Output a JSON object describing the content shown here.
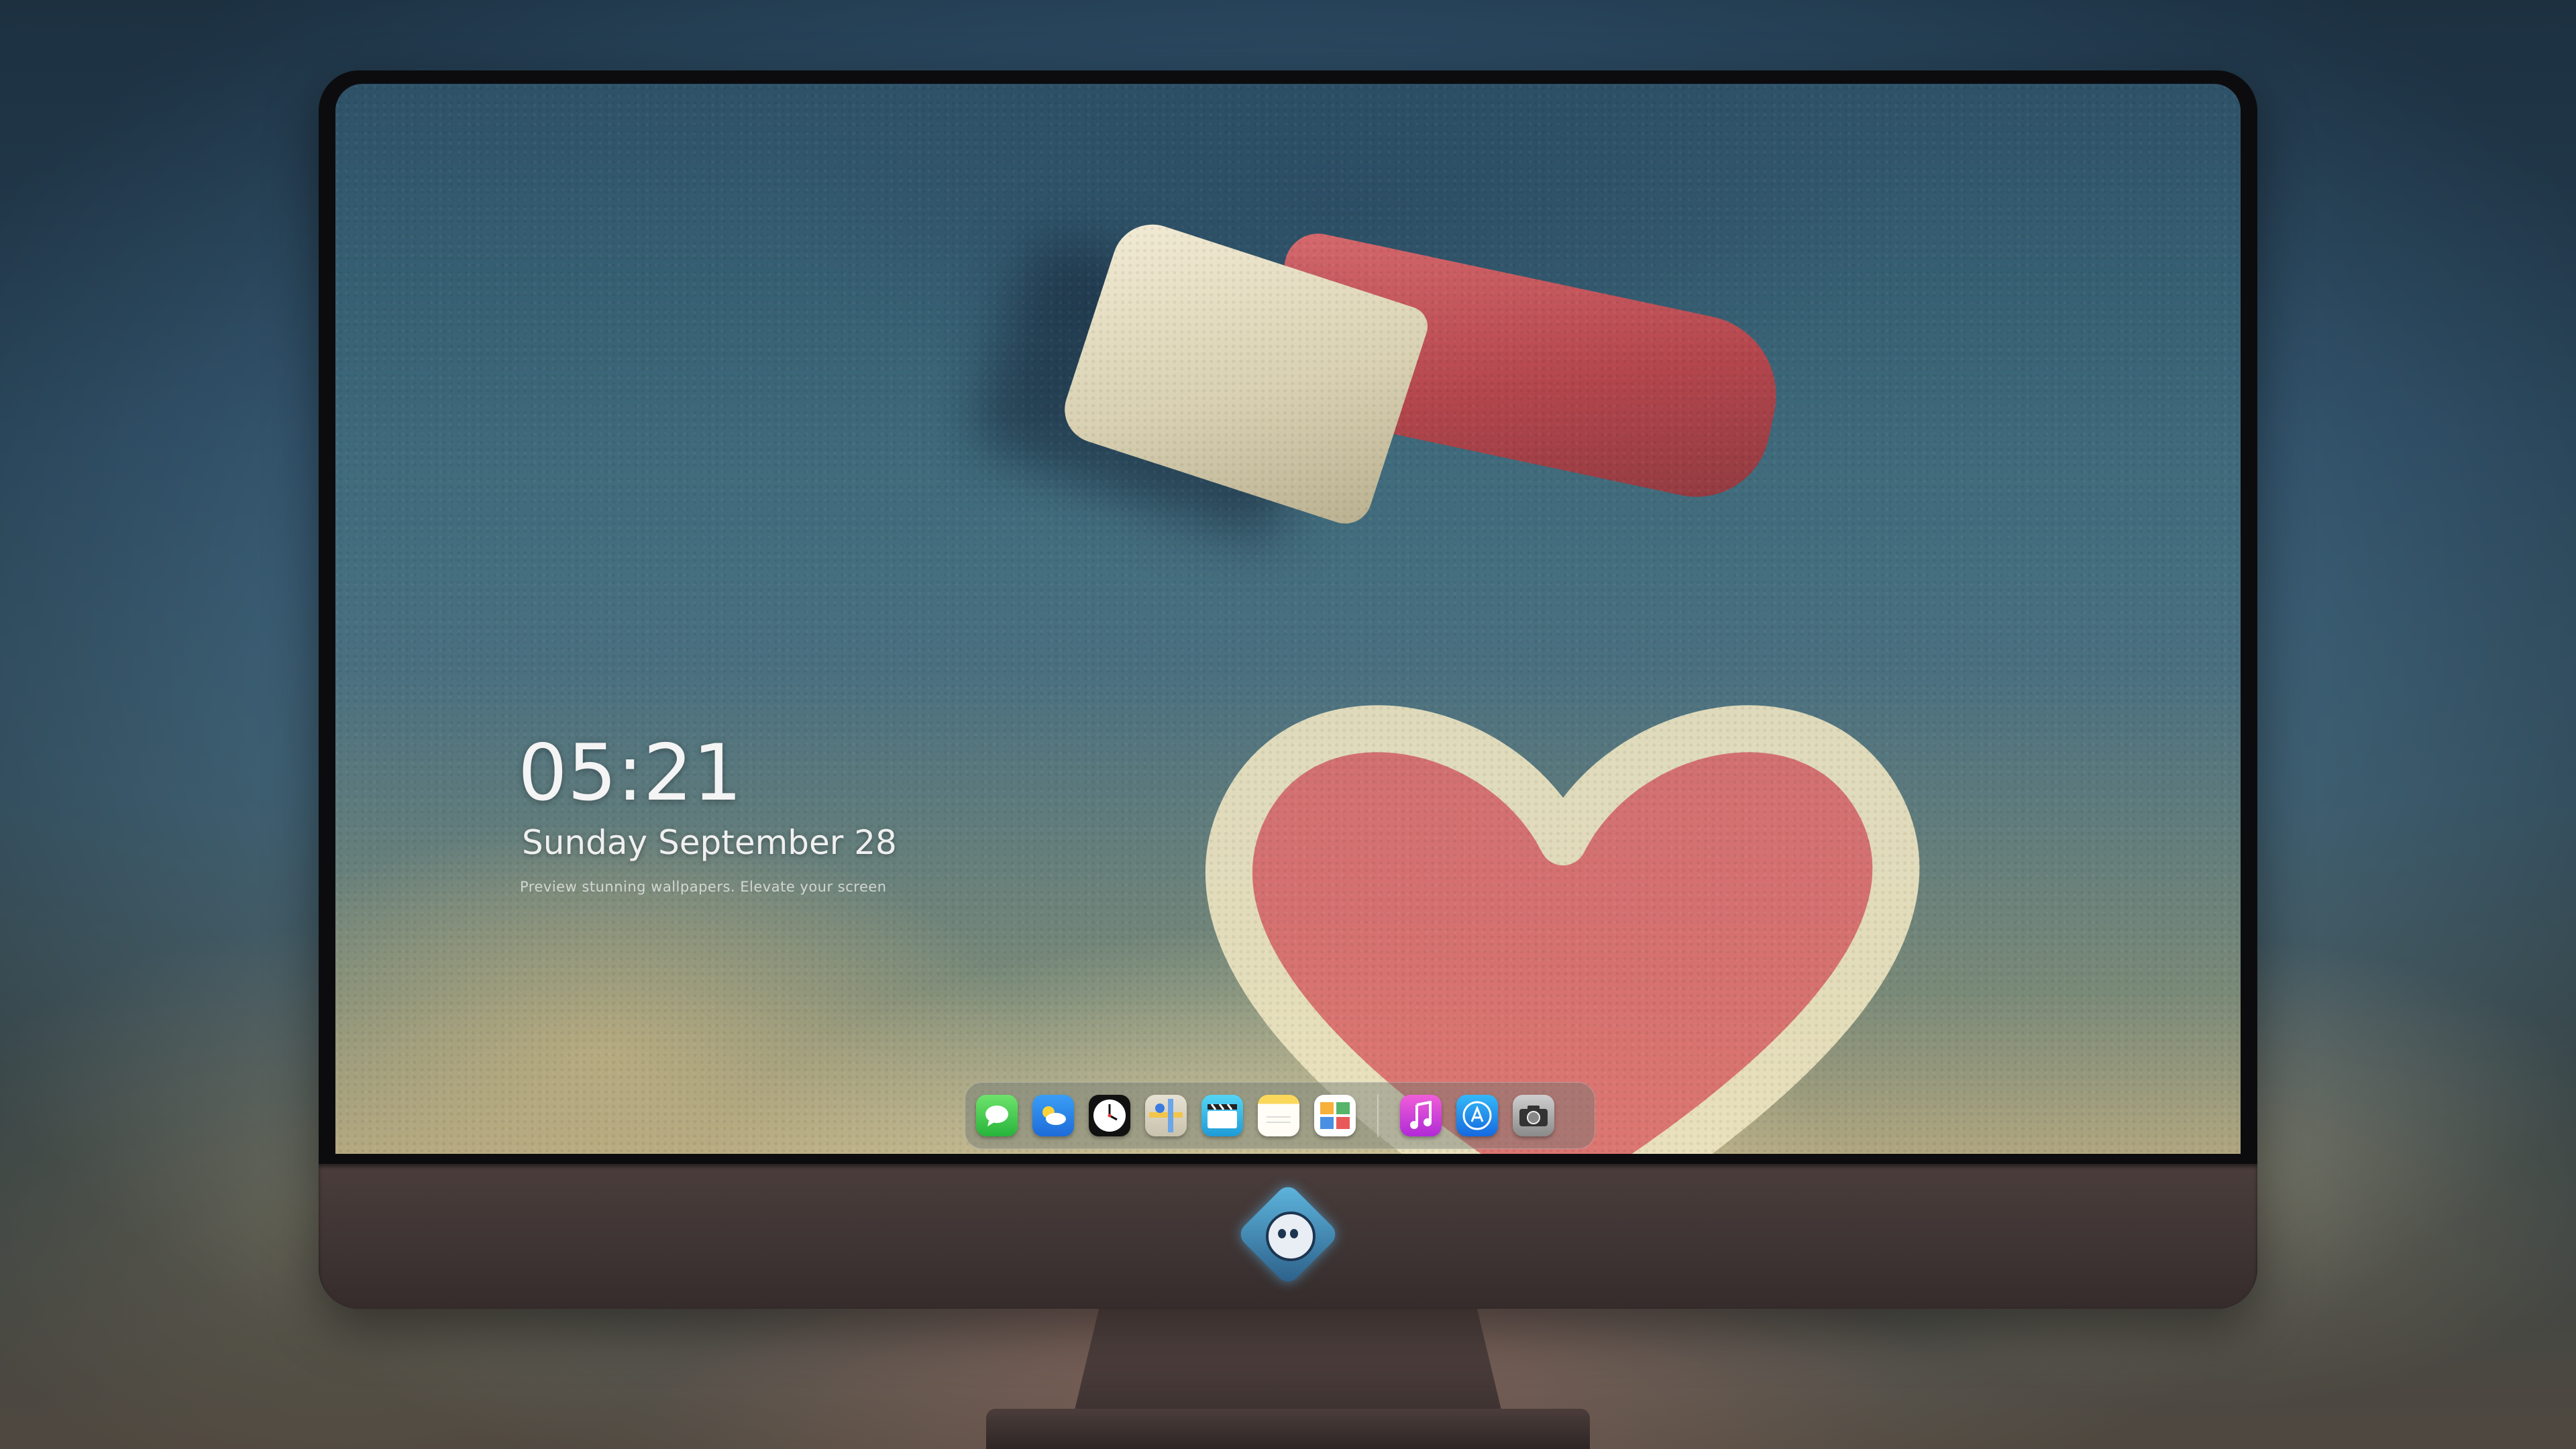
{
  "lockscreen": {
    "time": "05:21",
    "date": "Sunday September  28",
    "tagline": "Preview stunning wallpapers. Elevate your screen"
  },
  "dock": {
    "apps": [
      {
        "name": "Messages",
        "icon": "messages-icon"
      },
      {
        "name": "Weather",
        "icon": "weather-icon"
      },
      {
        "name": "Clock",
        "icon": "clock-icon"
      },
      {
        "name": "Maps",
        "icon": "maps-icon"
      },
      {
        "name": "Videos",
        "icon": "clapperboard-icon"
      },
      {
        "name": "Notes",
        "icon": "notes-icon"
      },
      {
        "name": "Calendar",
        "icon": "calendar-icon"
      }
    ],
    "pinned": [
      {
        "name": "Music",
        "icon": "music-note-icon"
      },
      {
        "name": "App Store",
        "icon": "app-store-icon"
      },
      {
        "name": "Camera",
        "icon": "camera-icon"
      }
    ]
  },
  "monitor": {
    "brand_logo": "mascot-logo-icon"
  },
  "colors": {
    "bezel": "#0c0c0e",
    "chin": "#3e3433",
    "accent_logo": "#5fb8e0"
  }
}
